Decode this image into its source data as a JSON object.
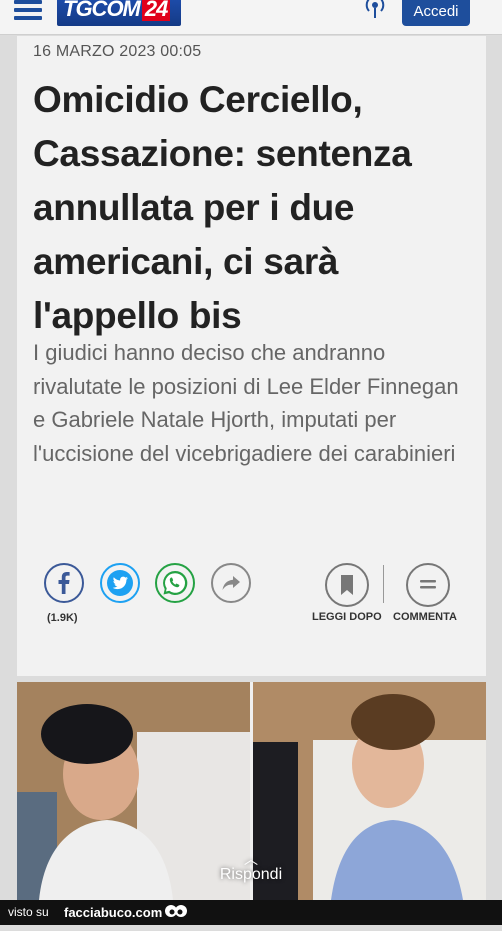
{
  "header": {
    "logo": {
      "text": "TGCOM",
      "number": "24"
    },
    "login_label": "Accedi",
    "icons": {
      "menu": "hamburger-menu-icon",
      "live": "broadcast-icon"
    },
    "colors": {
      "brand": "#1e4e9c",
      "logo_accent": "#e0001b"
    }
  },
  "article": {
    "date": "16 MARZO 2023 00:05",
    "title": "Omicidio Cerciello, Cassazione: sentenza annullata per i due americani, ci sarà l'appello bis",
    "summary": "I giudici hanno deciso che andranno rivalutate le posizioni di Lee Elder Finnegan e Gabriele Natale Hjorth, imputati per l'uccisione del vicebrigadiere dei carabinieri"
  },
  "share": {
    "facebook_count": "(1.9K)",
    "icons": [
      "facebook-icon",
      "twitter-icon",
      "whatsapp-icon",
      "share-icon"
    ],
    "colors": {
      "facebook": "#3b5998",
      "twitter": "#1da1f2",
      "whatsapp": "#25a244"
    },
    "read_later_label": "LEGGI DOPO",
    "comment_label": "COMMENTA"
  },
  "photo": {
    "reply_label": "Rispondi"
  },
  "footer": {
    "visto_su": "visto su",
    "site": "facciabuco.com"
  }
}
